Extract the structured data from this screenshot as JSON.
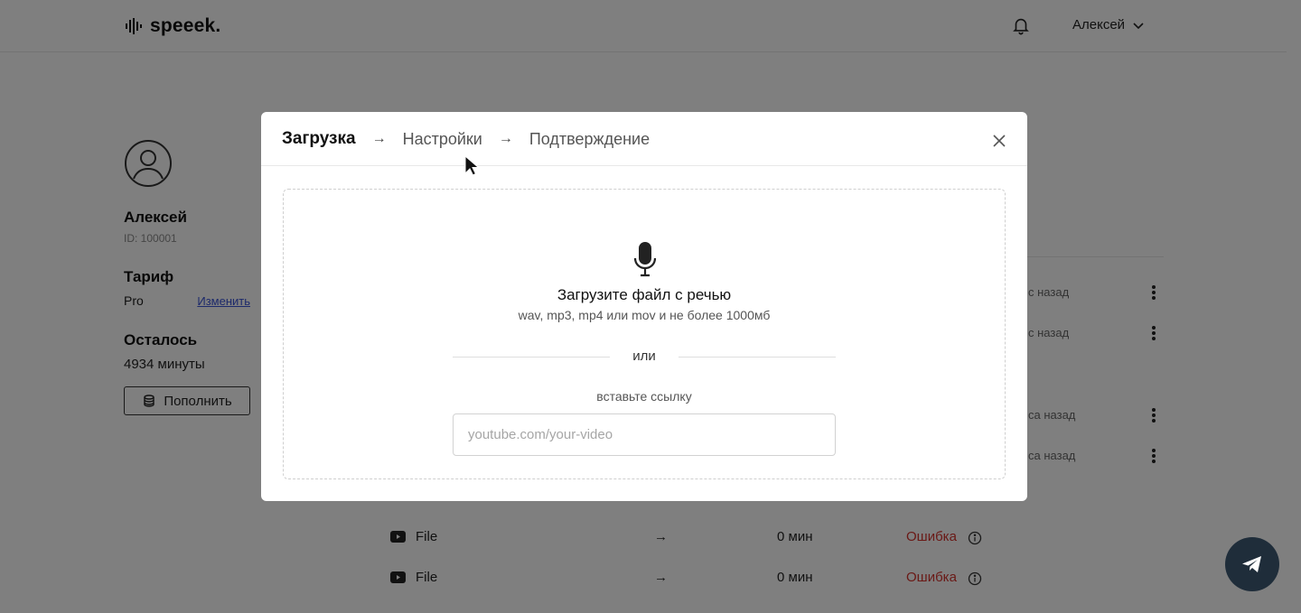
{
  "header": {
    "logo_text": "speeek.",
    "user_name": "Алексей"
  },
  "profile": {
    "name": "Алексей",
    "id": "ID: 100001",
    "tariff_title": "Тариф",
    "tariff_value": "Pro",
    "tariff_change": "Изменить",
    "remain_title": "Осталось",
    "remain_value": "4934 минуты",
    "topup_label": "Пополнить"
  },
  "history_rows": [
    {
      "time_tail": "с назад"
    },
    {
      "time_tail": "с назад"
    },
    {
      "time_tail": "са назад"
    },
    {
      "time_tail": "са назад"
    }
  ],
  "files": [
    {
      "name": "File",
      "arrow": "→",
      "duration": "0 мин",
      "status": "Ошибка"
    },
    {
      "name": "File",
      "arrow": "→",
      "duration": "0 мин",
      "status": "Ошибка"
    }
  ],
  "modal": {
    "steps": [
      "Загрузка",
      "Настройки",
      "Подтверждение"
    ],
    "step_arrow": "→",
    "active_step": 0,
    "drop_title": "Загрузите файл с речью",
    "drop_subtitle": "wav, mp3, mp4 или mov и не более 1000мб",
    "or_text": "или",
    "paste_label": "вставьте ссылку",
    "url_placeholder": "youtube.com/your-video",
    "url_value": ""
  },
  "colors": {
    "overlay": "rgba(0,0,0,0.5)",
    "error": "#d4322c",
    "link": "#3b55d6",
    "chat_button": "#1f2d3a"
  },
  "icons": [
    "logo-waveform-icon",
    "bell-icon",
    "chevron-down-icon",
    "avatar-icon",
    "coins-icon",
    "kebab-icon",
    "youtube-icon",
    "info-icon",
    "close-icon",
    "microphone-icon",
    "telegram-icon",
    "cursor-icon"
  ]
}
